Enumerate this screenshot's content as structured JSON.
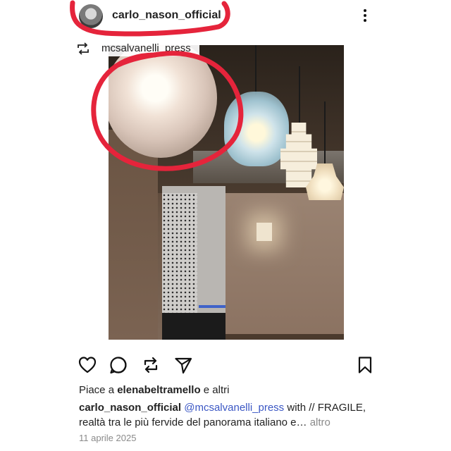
{
  "post": {
    "username": "carlo_nason_official",
    "repost_label": "mcsalvanelli_press",
    "likes": {
      "prefix": "Piace a",
      "user": "elenabeltramello",
      "suffix": "e altri"
    },
    "caption": {
      "user": "carlo_nason_official",
      "mention": "@mcsalvanelli_press",
      "text_1": " with // FRAGILE,",
      "text_2": "realtà tra le più fervide del panorama italiano e…",
      "more": "altro"
    },
    "date": "11 aprile 2025"
  },
  "icons": {
    "menu": "more-vertical-icon",
    "repost": "repost-icon",
    "like": "heart-icon",
    "comment": "comment-icon",
    "share": "repost-arrows-icon",
    "send": "send-icon",
    "save": "bookmark-icon"
  },
  "colors": {
    "annotation": "#e5243b",
    "mention": "#3b57c4",
    "muted": "#8a8a8a"
  }
}
